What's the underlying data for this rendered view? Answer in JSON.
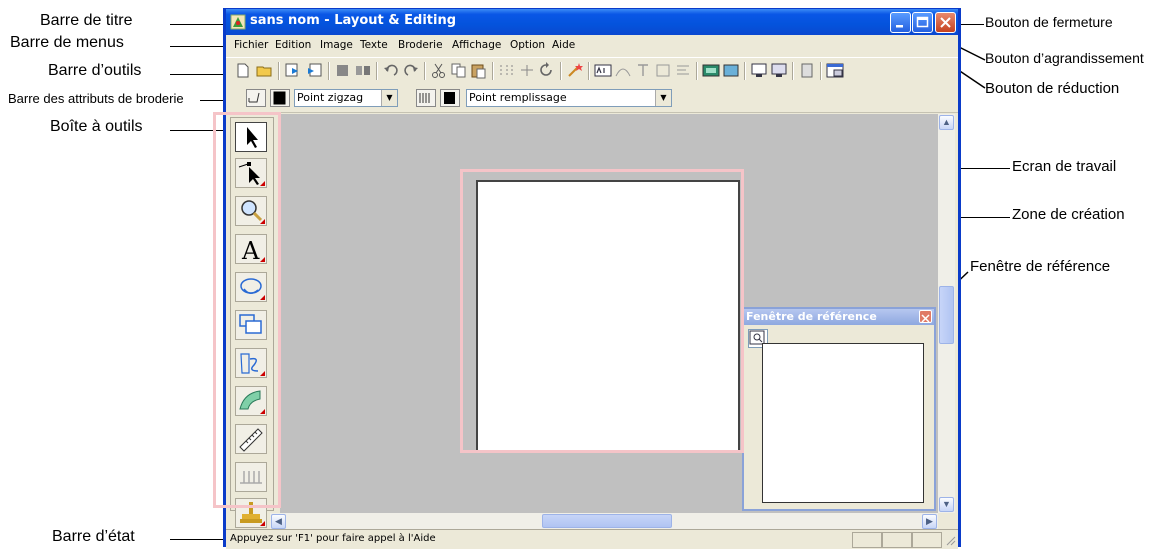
{
  "window": {
    "title": "sans nom - Layout & Editing",
    "menus": [
      "Fichier",
      "Edition",
      "Image",
      "Texte",
      "Broderie",
      "Affichage",
      "Option",
      "Aide"
    ]
  },
  "attributes_bar": {
    "line_stitch": "Point zigzag",
    "fill_stitch": "Point remplissage"
  },
  "reference_window": {
    "title": "Fenêtre de référence"
  },
  "status_bar": {
    "text": "Appuyez sur 'F1' pour faire appel à l'Aide"
  },
  "annotations": {
    "title_bar": "Barre de titre",
    "menu_bar": "Barre de menus",
    "toolbar": "Barre d’outils",
    "embroidery_attributes_bar": "Barre des attributs de broderie",
    "toolbox": "Boîte à outils",
    "status_bar": "Barre d’état",
    "close_button": "Bouton de fermeture",
    "maximize_button": "Bouton d’agrandissement",
    "minimize_button": "Bouton de réduction",
    "work_area": "Ecran de travail",
    "design_page": "Zone de création",
    "reference_window": "Fenêtre de référence"
  },
  "colors": {
    "title_bar": "#0453dc",
    "highlight_frame": "#f5c4c8",
    "work_area": "#c0c0c0"
  }
}
